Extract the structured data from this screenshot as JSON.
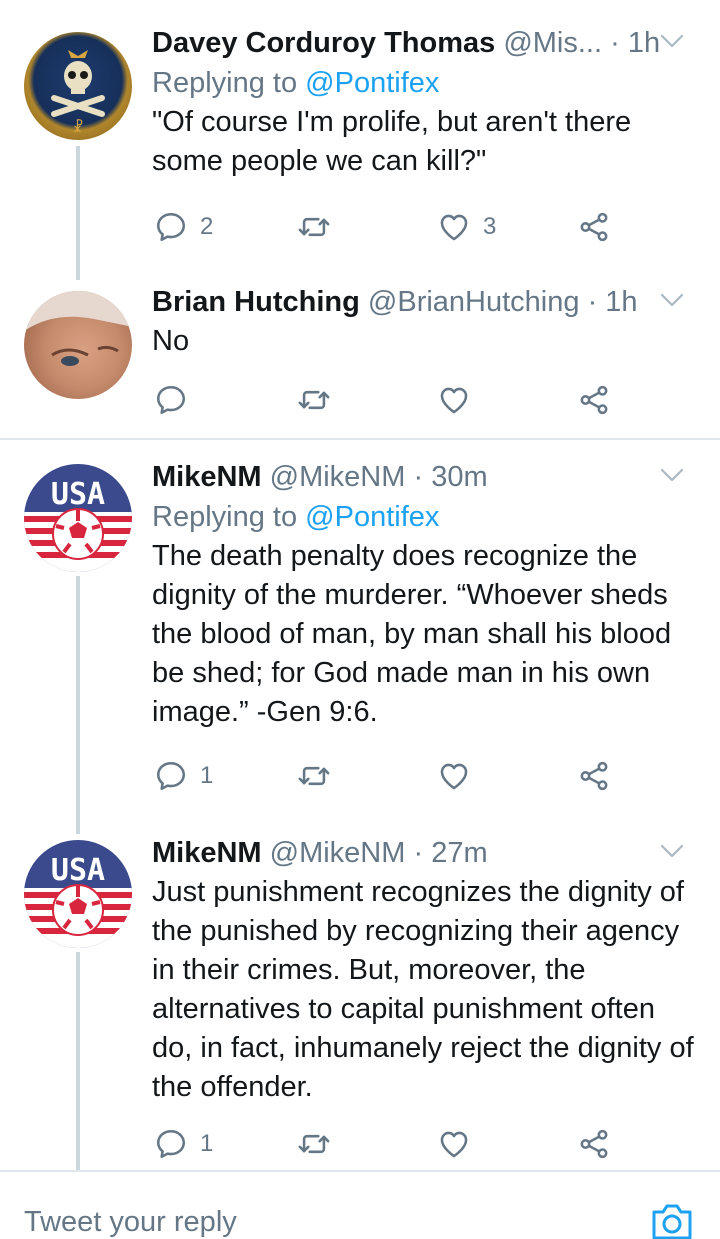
{
  "tweets": [
    {
      "name": "Davey Corduroy Thomas",
      "handle": "@Mis...",
      "time": "· 1h",
      "replying_label": "Replying to",
      "replying_to": "@Pontifex",
      "text": "\"Of course I'm prolife, but aren't there some people we can kill?\"",
      "reply_count": "2",
      "retweet_count": "",
      "like_count": "3"
    },
    {
      "name": "Brian Hutching",
      "handle": "@BrianHutching",
      "time": "· 1h",
      "text": "No",
      "reply_count": "",
      "retweet_count": "",
      "like_count": ""
    },
    {
      "name": "MikeNM",
      "handle": "@MikeNM",
      "time": "· 30m",
      "replying_label": "Replying to",
      "replying_to": "@Pontifex",
      "text": "The death penalty does recognize the dignity of the murderer. “Whoever sheds the blood of man, by man shall his blood be shed; for God made man in his own image.” -Gen 9:6.",
      "reply_count": "1",
      "retweet_count": "",
      "like_count": ""
    },
    {
      "name": "MikeNM",
      "handle": "@MikeNM",
      "time": "· 27m",
      "text": "Just punishment recognizes the dignity of the punished by recognizing their agency in their crimes. But, moreover, the alternatives to capital punishment often do, in fact, inhumanely reject the dignity of the offender.",
      "reply_count": "1",
      "retweet_count": "",
      "like_count": ""
    }
  ],
  "avatar_usa_text": "USA",
  "reply_bar": {
    "placeholder": "Tweet your reply"
  },
  "colors": {
    "link": "#1da1f2",
    "muted": "#657786",
    "text": "#14171a",
    "line": "#ccd6dd",
    "usa_blue": "#3b4a8c",
    "usa_red": "#d7263d"
  }
}
